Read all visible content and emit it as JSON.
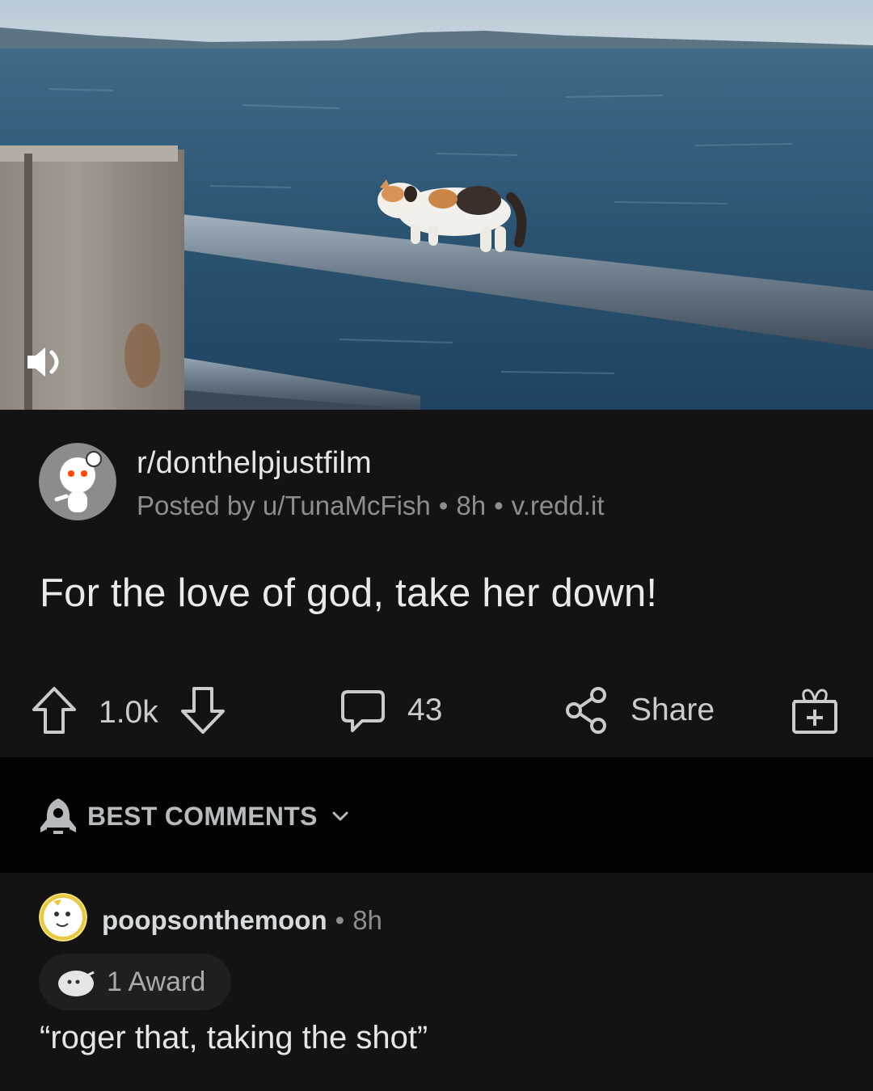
{
  "post": {
    "subreddit": "r/donthelpjustfilm",
    "posted_by": "Posted by u/TunaMcFish",
    "age": "8h",
    "domain": "v.redd.it",
    "title": "For the love of god, take her down!",
    "upvotes": "1.0k",
    "comments": "43",
    "share_label": "Share"
  },
  "icons": {
    "mute": "volume-icon",
    "upvote": "upvote-arrow-icon",
    "downvote": "downvote-arrow-icon",
    "comment": "comment-bubble-icon",
    "share": "share-icon",
    "award": "gift-award-icon",
    "sort": "rocket-icon",
    "chevron": "chevron-down-icon"
  },
  "sort": {
    "label": "BEST COMMENTS"
  },
  "comment": {
    "username": "poopsonthemoon",
    "age": "8h",
    "awards": "1 Award",
    "body": "“roger that, taking the shot”"
  },
  "colors": {
    "background": "#131313",
    "sort_bar": "#030303",
    "text_primary": "#d7dadc",
    "text_meta": "#8b8e90"
  }
}
